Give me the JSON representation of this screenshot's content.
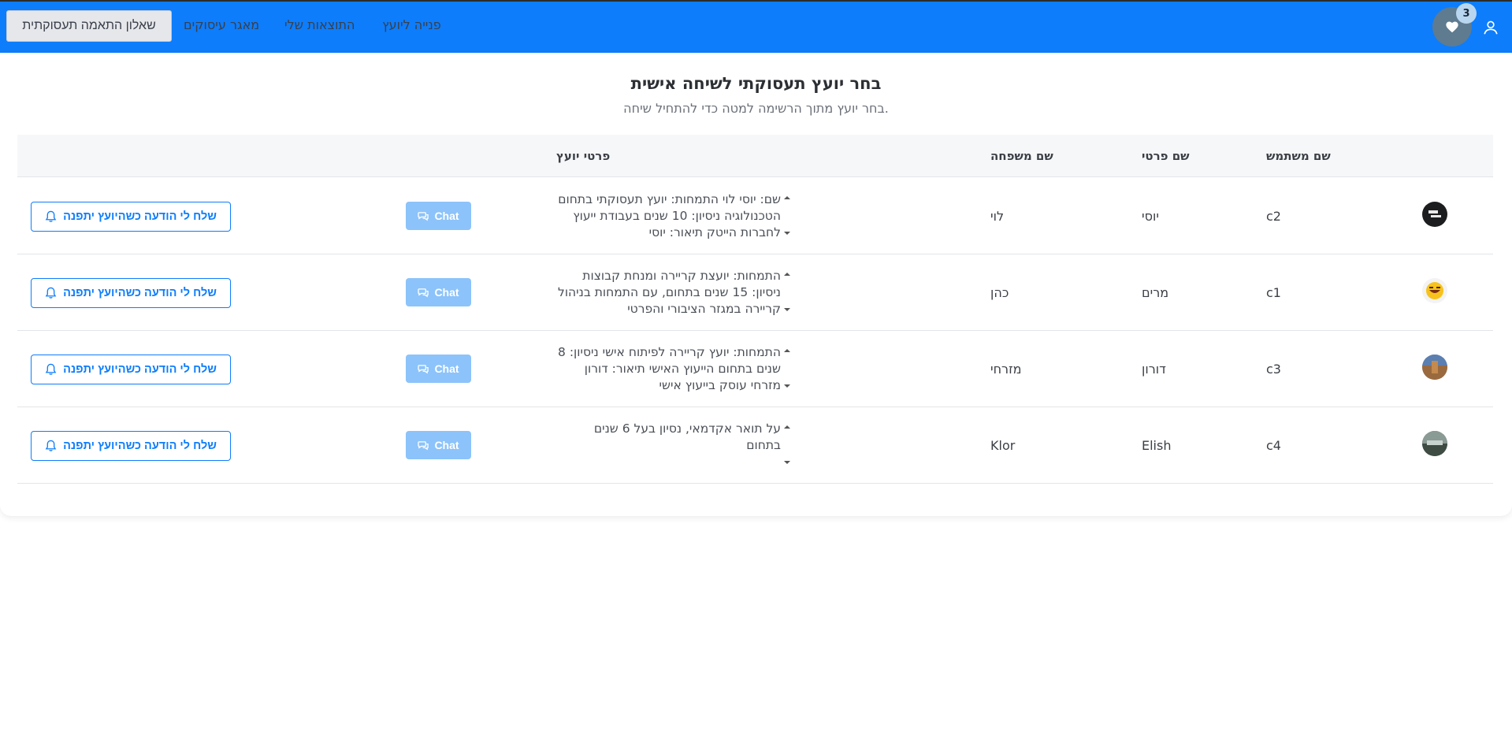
{
  "nav": {
    "active_label": "שאלון התאמה תעסוקתית",
    "links": [
      "מאגר עיסוקים",
      "התוצאות שלי",
      "פנייה ליועץ"
    ],
    "favorites_count": "3",
    "profile_icon": "person-icon",
    "favorites_icon": "heart-icon"
  },
  "page": {
    "title": "בחר יועץ תעסוקתי לשיחה אישית",
    "subtitle": ".בחר יועץ מתוך הרשימה למטה כדי להתחיל שיחה"
  },
  "table": {
    "headers": {
      "username": "שם משתמש",
      "first_name": "שם פרטי",
      "last_name": "שם משפחה",
      "details": "פרטי יועץ"
    },
    "chat_label": "Chat",
    "notify_label": "שלח לי הודעה כשהיועץ יתפנה",
    "rows": [
      {
        "username": "c2",
        "first_name": "יוסי",
        "last_name": "לוי",
        "details": "שם: יוסי לוי התמחות: יועץ תעסוקתי בתחום הטכנולוגיה ניסיון: 10 שנים בעבודת ייעוץ לחברות הייטק תיאור: יוסי"
      },
      {
        "username": "c1",
        "first_name": "מרים",
        "last_name": "כהן",
        "details": "התמחות: יועצת קריירה ומנחת קבוצות ניסיון: 15 שנים בתחום, עם התמחות בניהול קריירה במגזר הציבורי והפרטי"
      },
      {
        "username": "c3",
        "first_name": "דורון",
        "last_name": "מזרחי",
        "details": "התמחות: יועץ קריירה לפיתוח אישי ניסיון: 8 שנים בתחום הייעוץ האישי תיאור: דורון מזרחי עוסק בייעוץ אישי"
      },
      {
        "username": "c4",
        "first_name": "Elish",
        "last_name": "Klor",
        "details": "על תואר אקדמאי, נסיון בעל 6 שנים בתחום"
      }
    ]
  },
  "colors": {
    "navbar": "#0d7dfb",
    "chat_button": "#8cc3fa",
    "notify_border": "#0d7dfb"
  }
}
